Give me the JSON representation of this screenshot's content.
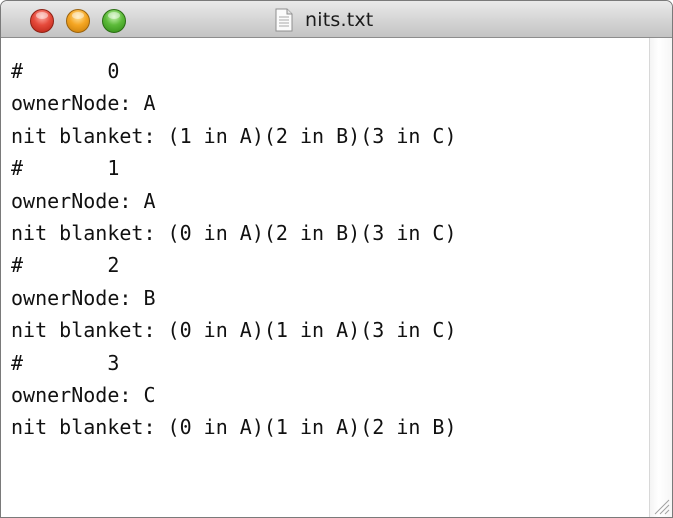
{
  "window": {
    "title": "nits.txt",
    "title_icon": "text-document-icon",
    "buttons": {
      "close": "close-icon",
      "minimize": "minimize-icon",
      "zoom": "zoom-icon"
    },
    "colors": {
      "close": "#e64b3c",
      "minimize": "#f5a623",
      "zoom": "#5dbb3a"
    }
  },
  "document": {
    "lines": [
      "#\t0",
      "ownerNode: A",
      "nit blanket: (1 in A)(2 in B)(3 in C)",
      "#\t1",
      "ownerNode: A",
      "nit blanket: (0 in A)(2 in B)(3 in C)",
      "#\t2",
      "ownerNode: B",
      "nit blanket: (0 in A)(1 in A)(3 in C)",
      "#\t3",
      "ownerNode: C",
      "nit blanket: (0 in A)(1 in A)(2 in B)"
    ]
  }
}
